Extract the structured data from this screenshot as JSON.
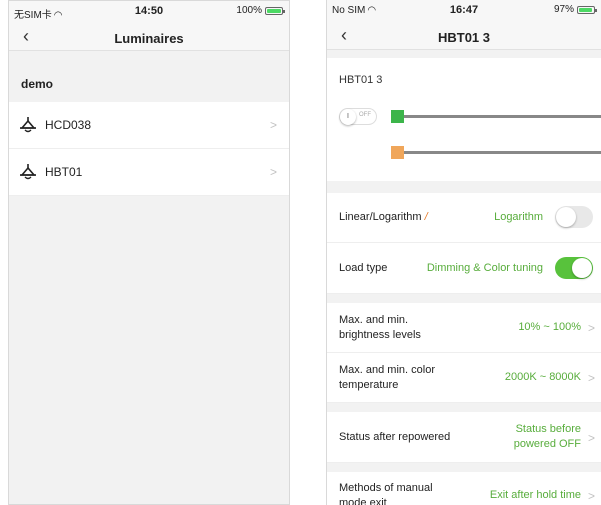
{
  "left": {
    "status_bar": {
      "carrier": "无SIM卡",
      "time": "14:50",
      "battery": "100%"
    },
    "nav": {
      "title": "Luminaires"
    },
    "section": {
      "header": "demo"
    },
    "items": [
      {
        "label": "HCD038"
      },
      {
        "label": "HBT01"
      }
    ]
  },
  "right": {
    "status_bar": {
      "carrier": "No SIM",
      "time": "16:47",
      "battery": "97%"
    },
    "nav": {
      "title": "HBT01 3"
    },
    "device": {
      "name": "HBT01 3",
      "power_switch": {
        "on_label": "I",
        "off_label": "OFF"
      }
    },
    "settings": {
      "linear_log": {
        "label": "Linear/Logarithm",
        "value": "Logarithm"
      },
      "load_type": {
        "label": "Load type",
        "value": "Dimming & Color tuning"
      },
      "brightness": {
        "label": "Max. and min. brightness levels",
        "value": "10% ~ 100%"
      },
      "color_temp": {
        "label": "Max. and min. color temperature",
        "value": "2000K ~ 8000K"
      },
      "repowered": {
        "label": "Status after repowered",
        "value": "Status before powered OFF"
      },
      "manual_exit": {
        "label": "Methods of manual mode exit",
        "value": "Exit after hold time"
      }
    },
    "colors": {
      "accent_green": "#58c23c",
      "brightness_thumb": "#3cb54a",
      "color_temp_thumb": "#f0a65a",
      "info_icon": "#e57b2a"
    }
  }
}
